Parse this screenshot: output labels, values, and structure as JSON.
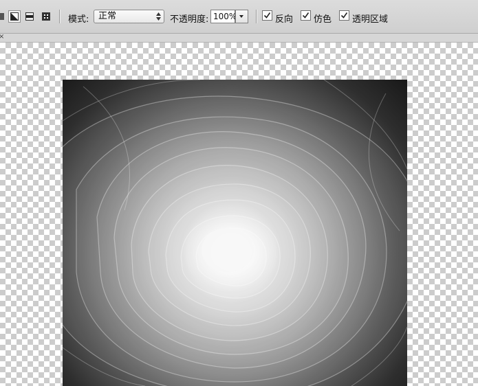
{
  "options_bar": {
    "mode_label": "模式:",
    "mode_value": "正常",
    "opacity_label": "不透明度:",
    "opacity_value": "100%",
    "reverse": {
      "label": "反向",
      "checked": true
    },
    "dither": {
      "label": "仿色",
      "checked": true
    },
    "transparency": {
      "label": "透明区域",
      "checked": true
    }
  },
  "canvas": {
    "image": "radial-gradient-swirl",
    "background": "transparency-checkerboard"
  },
  "colors": {
    "toolbar_bg": "#d3d3d3",
    "image_center": "#f2f2f2",
    "image_edge": "#1a1a1a"
  }
}
